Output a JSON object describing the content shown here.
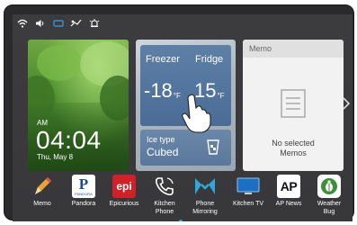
{
  "status_icons": [
    "wifi-icon",
    "volume-icon",
    "network-icon",
    "signal-icon",
    "alarm-icon"
  ],
  "clock": {
    "period": "AM",
    "time": "04:04",
    "date": "Thu, May 8"
  },
  "fridge": {
    "freezer_label": "Freezer",
    "fridge_label": "Fridge",
    "freezer_temp": "-18",
    "fridge_temp": "15",
    "unit": "°F",
    "ice_label": "Ice type",
    "ice_value": "Cubed"
  },
  "memo": {
    "title": "Memo",
    "empty_line1": "No selected",
    "empty_line2": "Memos"
  },
  "apps": [
    {
      "label": "Memo",
      "icon": "pencil-icon"
    },
    {
      "label": "Pandora",
      "icon": "pandora-icon",
      "glyph": "P",
      "sub": "PANDORA"
    },
    {
      "label": "Epicurious",
      "icon": "epicurious-icon",
      "glyph": "epi"
    },
    {
      "label": "Kitchen",
      "label2": "Phone",
      "icon": "phone-icon"
    },
    {
      "label": "Phone",
      "label2": "Mirroring",
      "icon": "mirroring-icon"
    },
    {
      "label": "Kitchen TV",
      "icon": "tv-icon"
    },
    {
      "label": "AP News",
      "icon": "ap-news-icon",
      "glyph": "AP"
    },
    {
      "label": "Weather",
      "label2": "Bug",
      "icon": "weather-bug-icon"
    }
  ],
  "colors": {
    "screen_bg": "#3c3c3f",
    "fridge_panel": "#4a6c96",
    "accent": "#3aa0e0"
  }
}
